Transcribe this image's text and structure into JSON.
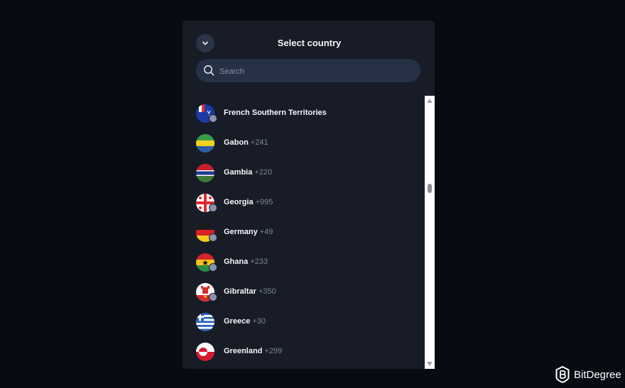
{
  "header": {
    "title": "Select country",
    "collapse_icon": "chevron-down-icon"
  },
  "search": {
    "placeholder": "Search",
    "icon": "search-icon"
  },
  "countries": [
    {
      "name": "French Southern Territories",
      "code": "",
      "flag": "flag-french-southern-territories",
      "badge": true
    },
    {
      "name": "Gabon",
      "code": "+241",
      "flag": "flag-gabon",
      "badge": false
    },
    {
      "name": "Gambia",
      "code": "+220",
      "flag": "flag-gambia",
      "badge": false
    },
    {
      "name": "Georgia",
      "code": "+995",
      "flag": "flag-georgia",
      "badge": true
    },
    {
      "name": "Germany",
      "code": "+49",
      "flag": "flag-germany",
      "badge": true
    },
    {
      "name": "Ghana",
      "code": "+233",
      "flag": "flag-ghana",
      "badge": true
    },
    {
      "name": "Gibraltar",
      "code": "+350",
      "flag": "flag-gibraltar",
      "badge": true
    },
    {
      "name": "Greece",
      "code": "+30",
      "flag": "flag-greece",
      "badge": false
    },
    {
      "name": "Greenland",
      "code": "+299",
      "flag": "flag-greenland",
      "badge": false
    }
  ],
  "watermark": {
    "brand": "BitDegree",
    "logo_icon": "bitdegree-logo-icon"
  }
}
